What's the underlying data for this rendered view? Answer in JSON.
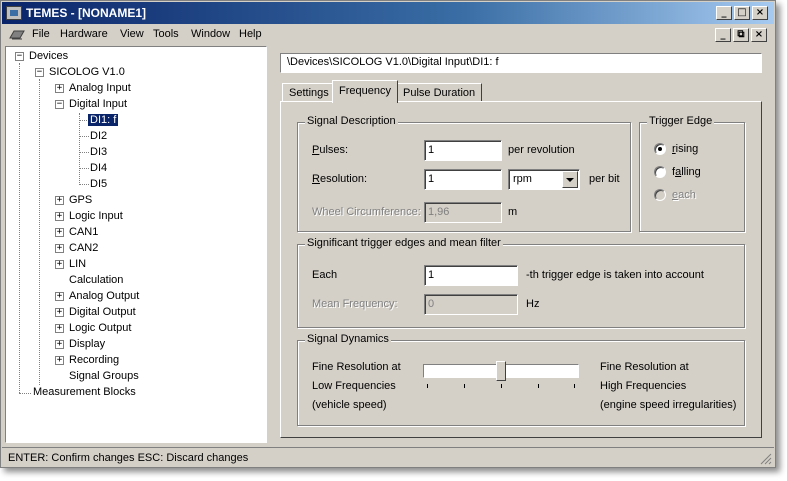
{
  "window": {
    "title": "TEMES - [NONAME1]",
    "caption_buttons": [
      "_",
      "□",
      "×"
    ],
    "mdi_buttons": [
      "_",
      "⧉",
      "×"
    ]
  },
  "menu": [
    "File",
    "Hardware",
    "View",
    "Tools",
    "Window",
    "Help"
  ],
  "tree": {
    "root": "Devices",
    "sicolog": "SICOLOG V1.0",
    "analog_input": "Analog Input",
    "digital_input": "Digital Input",
    "di_items": [
      "DI1: f",
      "DI2",
      "DI3",
      "DI4",
      "DI5"
    ],
    "rest": [
      "GPS",
      "Logic Input",
      "CAN1",
      "CAN2",
      "LIN",
      "Calculation",
      "Analog Output",
      "Digital Output",
      "Logic Output",
      "Display",
      "Recording",
      "Signal Groups"
    ],
    "measurement_blocks": "Measurement Blocks"
  },
  "path": "\\Devices\\SICOLOG V1.0\\Digital Input\\DI1: f",
  "tabs": [
    "Settings",
    "Frequency",
    "Pulse Duration"
  ],
  "signal_description": {
    "title": "Signal Description",
    "pulses_label": "Pulses:",
    "pulses_value": "1",
    "pulses_unit": "per revolution",
    "resolution_label": "Resolution:",
    "resolution_value": "1",
    "resolution_unit_select": "rpm",
    "resolution_unit": "per bit",
    "wheel_label": "Wheel Circumference:",
    "wheel_value": "1,96",
    "wheel_unit": "m"
  },
  "trigger_edge": {
    "title": "Trigger Edge",
    "options": [
      "rising",
      "falling",
      "each"
    ],
    "selected": "rising"
  },
  "mean_filter": {
    "title": "Significant trigger edges and mean filter",
    "each_label": "Each",
    "each_value": "1",
    "each_suffix": "-th trigger edge is taken into account",
    "mean_label": "Mean Frequency:",
    "mean_value": "0",
    "mean_unit": "Hz"
  },
  "signal_dynamics": {
    "title": "Signal Dynamics",
    "left_lines": [
      "Fine Resolution at",
      "Low Frequencies",
      "(vehicle speed)"
    ],
    "right_lines": [
      "Fine Resolution at",
      "High Frequencies",
      "(engine speed irregularities)"
    ],
    "slider_value": 0.5
  },
  "status": "ENTER: Confirm changes    ESC: Discard changes"
}
